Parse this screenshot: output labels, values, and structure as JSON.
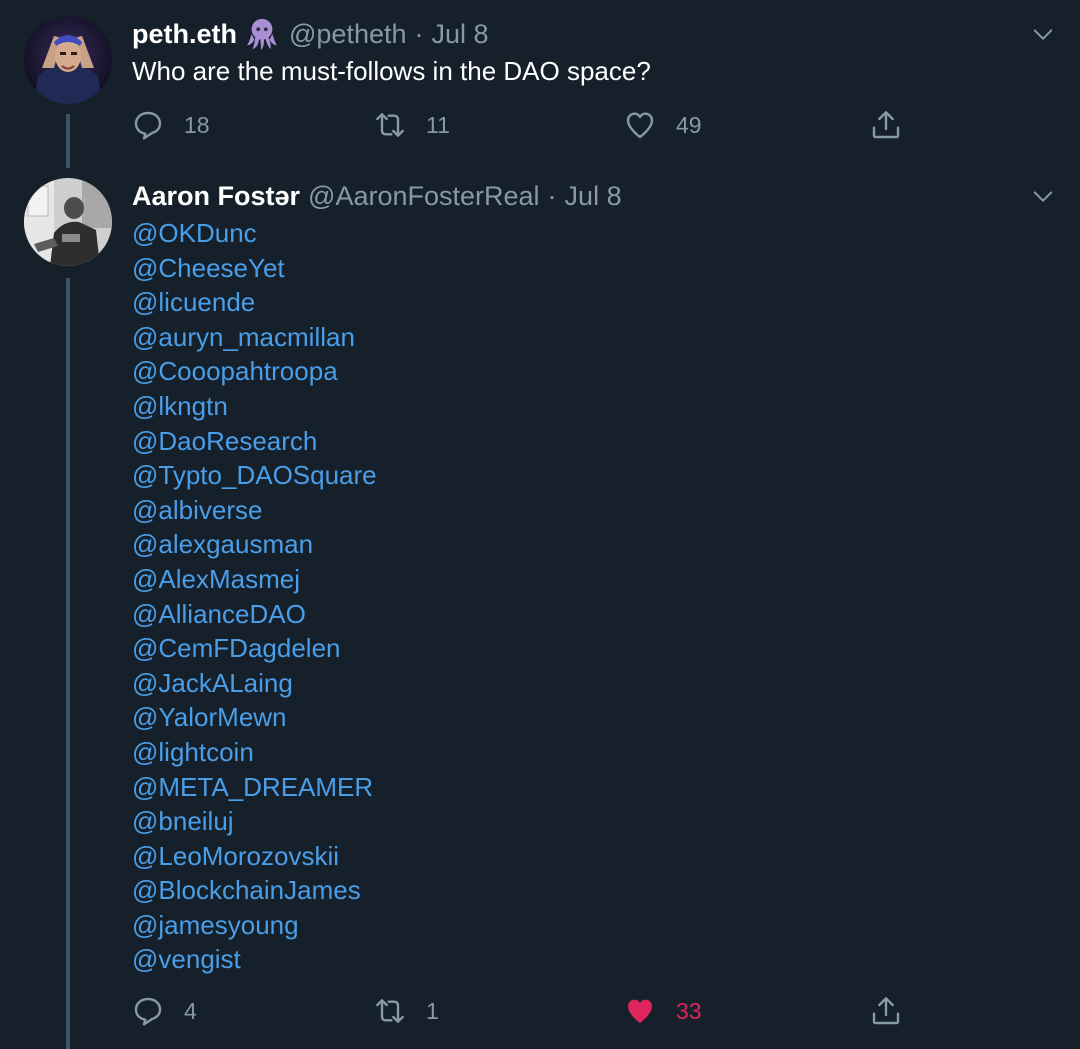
{
  "tweets": [
    {
      "display_name": "peth.eth",
      "name_emoji": "octopus",
      "handle": "@petheth",
      "separator": "·",
      "date": "Jul 8",
      "text": "Who are the must-follows in the DAO space?",
      "actions": {
        "replies": "18",
        "retweets": "11",
        "likes": "49",
        "liked": false
      }
    },
    {
      "display_name": "Aaron Fostǝr",
      "handle": "@AaronFosterReal",
      "separator": "·",
      "date": "Jul 8",
      "mentions": [
        "@OKDunc",
        "@CheeseYet",
        "@licuende",
        "@auryn_macmillan",
        "@Cooopahtroopa",
        "@lkngtn",
        "@DaoResearch",
        "@Typto_DAOSquare",
        "@albiverse",
        "@alexgausman",
        "@AlexMasmej",
        "@AllianceDAO",
        "@CemFDagdelen",
        "@JackALaing",
        "@YalorMewn",
        "@lightcoin",
        "@META_DREAMER",
        "@bneiluj",
        "@LeoMorozovskii",
        "@BlockchainJames",
        "@jamesyoung",
        "@vengist"
      ],
      "actions": {
        "replies": "4",
        "retweets": "1",
        "likes": "33",
        "liked": true
      }
    }
  ],
  "colors": {
    "background": "#15202b",
    "link": "#4a9ee8",
    "secondary_text": "#8899a6",
    "like_active": "#e0245e",
    "thread_line": "#3d5466"
  }
}
